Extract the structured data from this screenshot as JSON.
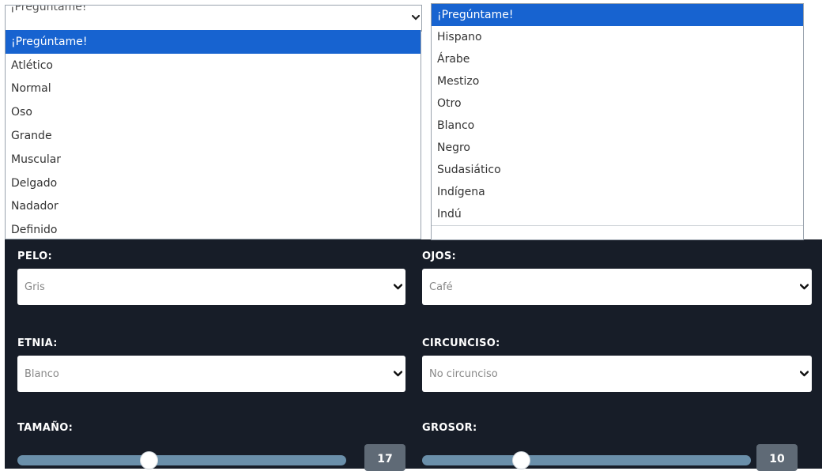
{
  "body_dropdown": {
    "current_value": "¡Pregúntame!",
    "options": [
      "¡Pregúntame!",
      "Atlético",
      "Normal",
      "Oso",
      "Grande",
      "Muscular",
      "Delgado",
      "Nadador",
      "Definido"
    ],
    "selected_index": 0
  },
  "ethnicity_dropdown": {
    "options": [
      "¡Pregúntame!",
      "Hispano",
      "Árabe",
      "Mestizo",
      "Otro",
      "Blanco",
      "Negro",
      "Sudasiático",
      "Indígena",
      "Indú"
    ],
    "selected_index": 0
  },
  "form": {
    "hair": {
      "label": "PELO:",
      "value": "Gris"
    },
    "eyes": {
      "label": "OJOS:",
      "value": "Café"
    },
    "ethnicity": {
      "label": "ETNIA:",
      "value": "Blanco"
    },
    "circumcised": {
      "label": "CIRCUNCISO:",
      "value": "No circunciso"
    },
    "size": {
      "label": "TAMAÑO:",
      "value": "17"
    },
    "thickness": {
      "label": "GROSOR:",
      "value": "10"
    }
  },
  "colors": {
    "panel_bg": "#171d28",
    "selected_option": "#1763d0",
    "slider_track": "#6a8faa",
    "value_badge": "#5f6a76"
  },
  "icons": {
    "select_chevron": "chevron-down-icon"
  }
}
